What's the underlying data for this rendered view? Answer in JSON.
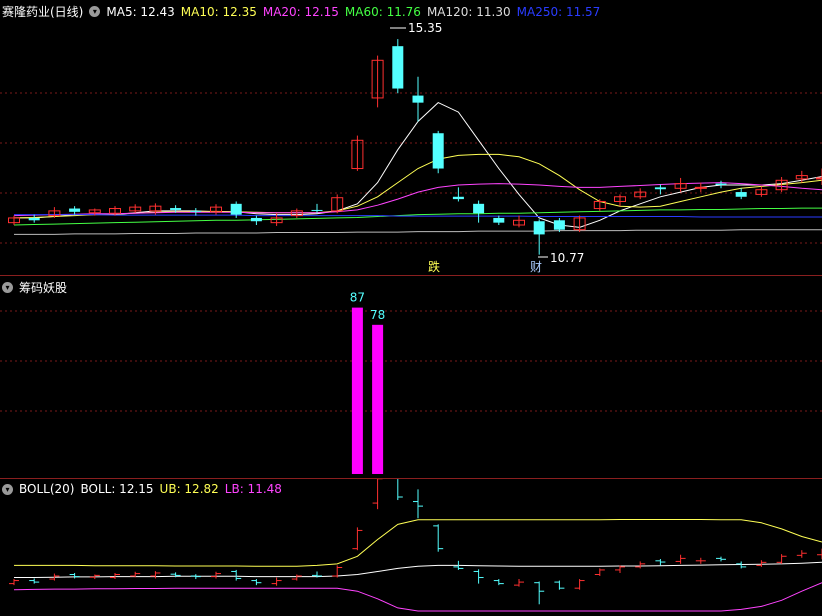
{
  "stock": {
    "title": "赛隆药业(日线)"
  },
  "ma": [
    {
      "label": "MA5: 12.43",
      "color": "#ffffff"
    },
    {
      "label": "MA10: 12.35",
      "color": "#ffff55"
    },
    {
      "label": "MA20: 12.15",
      "color": "#ff44ff"
    },
    {
      "label": "MA60: 11.76",
      "color": "#44ff44"
    },
    {
      "label": "MA120: 11.30",
      "color": "#dddddd"
    },
    {
      "label": "MA250: 11.57",
      "color": "#2a3cff"
    }
  ],
  "annotations": {
    "high": "15.35",
    "low": "10.77",
    "event1": "跌",
    "event2": "财"
  },
  "indicator2": {
    "title": "筹码妖股",
    "bar1": "87",
    "bar2": "78"
  },
  "boll": {
    "name": "BOLL(20)",
    "mid": "BOLL: 12.15",
    "ub": "UB: 12.82",
    "lb": "LB: 11.48"
  },
  "colors": {
    "up": "#ff3030",
    "down": "#54ffff",
    "bar": "#ff00ff",
    "grid": "#7a1a1a"
  },
  "chart_data": {
    "type": "candlestick",
    "candles": [
      {
        "o": 11.45,
        "c": 11.55,
        "h": 11.6,
        "l": 11.4
      },
      {
        "o": 11.55,
        "c": 11.5,
        "h": 11.62,
        "l": 11.45
      },
      {
        "o": 11.6,
        "c": 11.7,
        "h": 11.78,
        "l": 11.55
      },
      {
        "o": 11.75,
        "c": 11.68,
        "h": 11.8,
        "l": 11.62
      },
      {
        "o": 11.66,
        "c": 11.72,
        "h": 11.75,
        "l": 11.6
      },
      {
        "o": 11.65,
        "c": 11.75,
        "h": 11.8,
        "l": 11.6
      },
      {
        "o": 11.7,
        "c": 11.78,
        "h": 11.84,
        "l": 11.66
      },
      {
        "o": 11.7,
        "c": 11.8,
        "h": 11.86,
        "l": 11.62
      },
      {
        "o": 11.76,
        "c": 11.72,
        "h": 11.82,
        "l": 11.66
      },
      {
        "o": 11.7,
        "c": 11.68,
        "h": 11.76,
        "l": 11.6
      },
      {
        "o": 11.68,
        "c": 11.78,
        "h": 11.84,
        "l": 11.62
      },
      {
        "o": 11.85,
        "c": 11.62,
        "h": 11.9,
        "l": 11.55
      },
      {
        "o": 11.55,
        "c": 11.48,
        "h": 11.6,
        "l": 11.4
      },
      {
        "o": 11.45,
        "c": 11.55,
        "h": 11.65,
        "l": 11.38
      },
      {
        "o": 11.6,
        "c": 11.7,
        "h": 11.75,
        "l": 11.55
      },
      {
        "o": 11.72,
        "c": 11.7,
        "h": 11.85,
        "l": 11.65
      },
      {
        "o": 11.7,
        "c": 11.98,
        "h": 12.05,
        "l": 11.65
      },
      {
        "o": 12.6,
        "c": 13.2,
        "h": 13.3,
        "l": 12.55
      },
      {
        "o": 14.1,
        "c": 14.9,
        "h": 15.0,
        "l": 13.9
      },
      {
        "o": 15.2,
        "c": 14.3,
        "h": 15.35,
        "l": 14.2
      },
      {
        "o": 14.15,
        "c": 14.0,
        "h": 14.55,
        "l": 13.6
      },
      {
        "o": 13.35,
        "c": 12.6,
        "h": 13.4,
        "l": 12.5
      },
      {
        "o": 12.0,
        "c": 11.95,
        "h": 12.2,
        "l": 11.9
      },
      {
        "o": 11.85,
        "c": 11.65,
        "h": 11.92,
        "l": 11.45
      },
      {
        "o": 11.55,
        "c": 11.45,
        "h": 11.6,
        "l": 11.4
      },
      {
        "o": 11.4,
        "c": 11.5,
        "h": 11.6,
        "l": 11.35
      },
      {
        "o": 11.48,
        "c": 11.2,
        "h": 11.52,
        "l": 10.77
      },
      {
        "o": 11.5,
        "c": 11.3,
        "h": 11.55,
        "l": 11.25
      },
      {
        "o": 11.3,
        "c": 11.55,
        "h": 11.6,
        "l": 11.25
      },
      {
        "o": 11.75,
        "c": 11.9,
        "h": 11.95,
        "l": 11.7
      },
      {
        "o": 11.9,
        "c": 12.0,
        "h": 12.05,
        "l": 11.8
      },
      {
        "o": 12.0,
        "c": 12.1,
        "h": 12.18,
        "l": 11.95
      },
      {
        "o": 12.2,
        "c": 12.16,
        "h": 12.26,
        "l": 12.05
      },
      {
        "o": 12.18,
        "c": 12.28,
        "h": 12.4,
        "l": 12.1
      },
      {
        "o": 12.2,
        "c": 12.2,
        "h": 12.3,
        "l": 12.1
      },
      {
        "o": 12.28,
        "c": 12.25,
        "h": 12.34,
        "l": 12.18
      },
      {
        "o": 12.1,
        "c": 12.0,
        "h": 12.18,
        "l": 11.95
      },
      {
        "o": 12.05,
        "c": 12.15,
        "h": 12.22,
        "l": 12.0
      },
      {
        "o": 12.15,
        "c": 12.35,
        "h": 12.42,
        "l": 12.1
      },
      {
        "o": 12.38,
        "c": 12.45,
        "h": 12.55,
        "l": 12.3
      },
      {
        "o": 12.4,
        "c": 12.4,
        "h": 12.6,
        "l": 12.25
      }
    ],
    "ma_lines": {
      "MA5": [
        11.55,
        11.55,
        11.58,
        11.62,
        11.62,
        11.62,
        11.66,
        11.7,
        11.7,
        11.7,
        11.68,
        11.68,
        11.64,
        11.62,
        11.62,
        11.64,
        11.7,
        11.85,
        12.3,
        13.0,
        13.6,
        14.0,
        13.8,
        13.2,
        12.6,
        12.05,
        11.55,
        11.4,
        11.35,
        11.5,
        11.7,
        11.85,
        12.0,
        12.1,
        12.2,
        12.25,
        12.25,
        12.25,
        12.28,
        12.35,
        12.43
      ],
      "MA10": [
        11.55,
        11.56,
        11.58,
        11.6,
        11.62,
        11.63,
        11.65,
        11.67,
        11.68,
        11.69,
        11.69,
        11.68,
        11.67,
        11.66,
        11.66,
        11.66,
        11.7,
        11.8,
        12.0,
        12.3,
        12.6,
        12.8,
        12.88,
        12.9,
        12.9,
        12.85,
        12.7,
        12.45,
        12.15,
        11.9,
        11.8,
        11.78,
        11.8,
        11.9,
        12.0,
        12.1,
        12.18,
        12.22,
        12.26,
        12.3,
        12.35
      ],
      "MA20": [
        11.6,
        11.61,
        11.62,
        11.63,
        11.64,
        11.64,
        11.65,
        11.66,
        11.67,
        11.67,
        11.67,
        11.67,
        11.66,
        11.66,
        11.66,
        11.66,
        11.68,
        11.72,
        11.82,
        11.95,
        12.1,
        12.2,
        12.25,
        12.27,
        12.28,
        12.27,
        12.25,
        12.22,
        12.2,
        12.2,
        12.22,
        12.24,
        12.26,
        12.28,
        12.29,
        12.3,
        12.28,
        12.25,
        12.22,
        12.18,
        12.15
      ],
      "MA60": [
        11.4,
        11.41,
        11.42,
        11.43,
        11.44,
        11.45,
        11.46,
        11.47,
        11.48,
        11.49,
        11.5,
        11.5,
        11.51,
        11.52,
        11.53,
        11.54,
        11.55,
        11.56,
        11.58,
        11.6,
        11.62,
        11.63,
        11.64,
        11.64,
        11.65,
        11.65,
        11.66,
        11.67,
        11.68,
        11.69,
        11.7,
        11.71,
        11.72,
        11.72,
        11.73,
        11.73,
        11.74,
        11.75,
        11.75,
        11.76,
        11.76
      ],
      "MA120": [
        11.2,
        11.2,
        11.2,
        11.21,
        11.21,
        11.21,
        11.22,
        11.22,
        11.22,
        11.23,
        11.23,
        11.23,
        11.23,
        11.24,
        11.24,
        11.24,
        11.24,
        11.25,
        11.25,
        11.25,
        11.26,
        11.26,
        11.26,
        11.27,
        11.27,
        11.27,
        11.27,
        11.28,
        11.28,
        11.28,
        11.28,
        11.29,
        11.29,
        11.29,
        11.29,
        11.29,
        11.3,
        11.3,
        11.3,
        11.3,
        11.3
      ],
      "MA250": [
        11.62,
        11.62,
        11.62,
        11.62,
        11.62,
        11.61,
        11.61,
        11.61,
        11.61,
        11.61,
        11.61,
        11.61,
        11.6,
        11.6,
        11.6,
        11.6,
        11.6,
        11.6,
        11.6,
        11.59,
        11.59,
        11.59,
        11.59,
        11.59,
        11.59,
        11.59,
        11.58,
        11.58,
        11.58,
        11.58,
        11.58,
        11.58,
        11.58,
        11.58,
        11.57,
        11.57,
        11.57,
        11.57,
        11.57,
        11.57,
        11.57
      ]
    },
    "yrange": [
      10.55,
      15.65
    ],
    "indicator_bars": [
      {
        "index": 17,
        "value": 87
      },
      {
        "index": 18,
        "value": 78
      }
    ],
    "indicator_range": [
      0,
      100
    ],
    "boll_ub": [
      12.05,
      12.05,
      12.05,
      12.05,
      12.04,
      12.04,
      12.04,
      12.04,
      12.03,
      12.03,
      12.03,
      12.03,
      12.02,
      12.02,
      12.02,
      12.05,
      12.1,
      12.35,
      12.9,
      13.4,
      13.55,
      13.55,
      13.55,
      13.55,
      13.55,
      13.55,
      13.55,
      13.55,
      13.55,
      13.55,
      13.56,
      13.56,
      13.56,
      13.56,
      13.56,
      13.55,
      13.55,
      13.45,
      13.25,
      13.0,
      12.82
    ],
    "boll_mid": [
      11.65,
      11.65,
      11.66,
      11.67,
      11.67,
      11.68,
      11.68,
      11.68,
      11.69,
      11.69,
      11.69,
      11.69,
      11.68,
      11.68,
      11.68,
      11.68,
      11.7,
      11.75,
      11.85,
      11.95,
      12.02,
      12.05,
      12.05,
      12.04,
      12.03,
      12.02,
      12.02,
      12.02,
      12.02,
      12.02,
      12.03,
      12.03,
      12.04,
      12.05,
      12.06,
      12.07,
      12.08,
      12.09,
      12.1,
      12.12,
      12.15
    ],
    "boll_lb": [
      11.25,
      11.26,
      11.27,
      11.27,
      11.28,
      11.28,
      11.29,
      11.29,
      11.3,
      11.3,
      11.3,
      11.3,
      11.3,
      11.3,
      11.3,
      11.3,
      11.3,
      11.2,
      10.95,
      10.65,
      10.55,
      10.55,
      10.55,
      10.55,
      10.55,
      10.55,
      10.55,
      10.55,
      10.55,
      10.55,
      10.55,
      10.55,
      10.55,
      10.55,
      10.55,
      10.55,
      10.6,
      10.7,
      10.9,
      11.2,
      11.48
    ],
    "boll_yrange": [
      10.45,
      14.3
    ]
  }
}
